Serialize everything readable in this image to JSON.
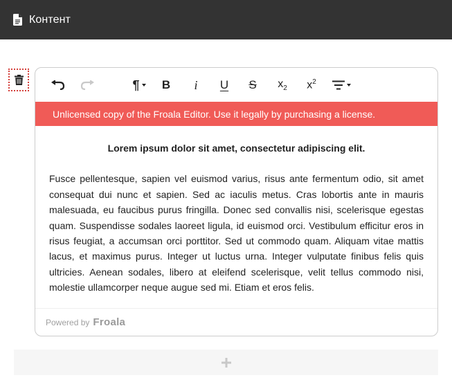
{
  "header": {
    "title": "Контент",
    "icon": "file-icon"
  },
  "block": {
    "delete_icon": "trash-icon"
  },
  "toolbar": {
    "buttons": [
      {
        "name": "undo",
        "icon": "undo-icon"
      },
      {
        "name": "redo",
        "icon": "redo-icon",
        "disabled": true
      },
      {
        "name": "paragraph-format",
        "icon": "pilcrow-icon"
      },
      {
        "name": "bold",
        "label": "B"
      },
      {
        "name": "italic",
        "label": "i"
      },
      {
        "name": "underline",
        "label": "U"
      },
      {
        "name": "strikethrough",
        "label": "S"
      },
      {
        "name": "subscript",
        "label": "x",
        "sub": "2"
      },
      {
        "name": "superscript",
        "label": "x",
        "sup": "2"
      },
      {
        "name": "align",
        "icon": "align-icon"
      }
    ]
  },
  "license_banner": "Unlicensed copy of the Froala Editor. Use it legally by purchasing a license.",
  "content": {
    "heading": "Lorem ipsum dolor sit amet, consectetur adipiscing elit.",
    "paragraph": "Fusce pellentesque, sapien vel euismod varius, risus ante fermentum odio, sit amet consequat dui nunc et sapien. Sed ac iaculis metus. Cras lobortis ante in mauris malesuada, eu faucibus purus fringilla. Donec sed convallis nisi, scelerisque egestas quam. Suspendisse sodales laoreet ligula, id euismod orci. Vestibulum efficitur eros in risus feugiat, a accumsan orci porttitor. Sed ut commodo quam. Aliquam vitae mattis lacus, et maximus purus. Integer ut luctus urna. Integer vulputate finibus felis quis ultricies. Aenean sodales, libero at eleifend scelerisque, velit tellus commodo nisi, molestie ullamcorper neque augue sed mi. Etiam et eros felis."
  },
  "powered_by": {
    "prefix": "Powered by",
    "brand": "Froala"
  },
  "add_block": {
    "icon": "plus-icon"
  },
  "colors": {
    "header_bg": "#333333",
    "license_bg": "#f05b57",
    "delete_border": "#d43f3a"
  }
}
